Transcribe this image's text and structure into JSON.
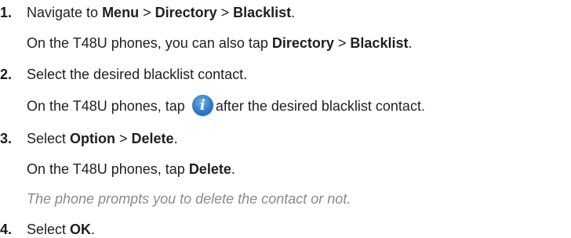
{
  "steps": [
    {
      "number": "1.",
      "main": [
        "Navigate to ",
        "Menu",
        " > ",
        "Directory",
        " > ",
        "Blacklist",
        "."
      ],
      "alt": [
        "On the T48U phones, you can also tap ",
        "Directory",
        " > ",
        "Blacklist",
        "."
      ]
    },
    {
      "number": "2.",
      "main": "Select the desired blacklist contact.",
      "alt_before": "On the T48U phones, tap ",
      "alt_icon": "info-icon",
      "alt_icon_glyph": "i",
      "alt_after": "after the desired blacklist contact."
    },
    {
      "number": "3.",
      "main": [
        "Select ",
        "Option",
        " > ",
        "Delete",
        "."
      ],
      "alt": [
        "On the T48U phones, tap ",
        "Delete",
        "."
      ],
      "note": "The phone prompts you to delete the contact or not."
    },
    {
      "number": "4.",
      "main": [
        "Select ",
        "OK",
        "."
      ]
    }
  ]
}
